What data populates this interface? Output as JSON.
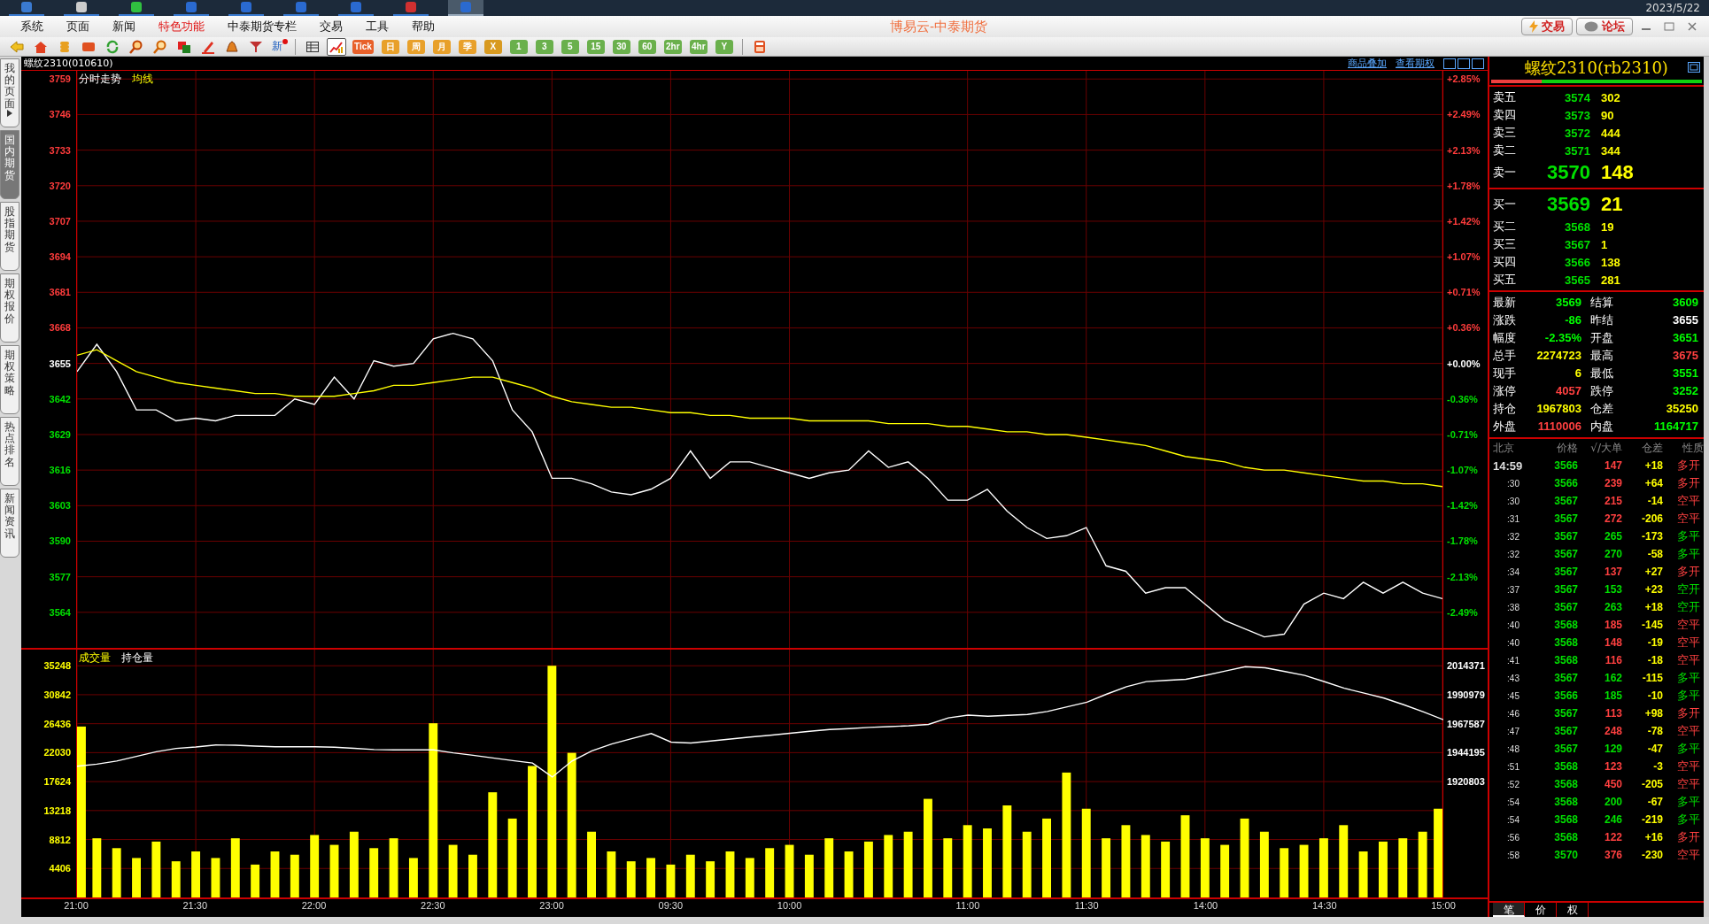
{
  "taskbar": {
    "apps": [
      {
        "selected": false
      },
      {
        "selected": false
      },
      {
        "selected": false
      },
      {
        "selected": false
      },
      {
        "selected": false
      },
      {
        "selected": false
      },
      {
        "selected": false
      },
      {
        "selected": false
      },
      {
        "selected": true
      }
    ],
    "date": "2023/5/22"
  },
  "menu": [
    {
      "label": "系统",
      "highlight": false
    },
    {
      "label": "页面",
      "highlight": false
    },
    {
      "label": "新闻",
      "highlight": false
    },
    {
      "label": "特色功能",
      "highlight": true
    },
    {
      "label": "中泰期货专栏",
      "highlight": false
    },
    {
      "label": "交易",
      "highlight": false
    },
    {
      "label": "工具",
      "highlight": false
    },
    {
      "label": "帮助",
      "highlight": false
    }
  ],
  "app_title": "博易云-中泰期货",
  "header_buttons": [
    {
      "label": "交易",
      "kind": "trade"
    },
    {
      "label": "论坛",
      "kind": "forum"
    }
  ],
  "toolbar": [
    {
      "kind": "icon",
      "selected": false
    },
    {
      "kind": "icon",
      "selected": false
    },
    {
      "kind": "icon",
      "selected": false
    },
    {
      "kind": "icon",
      "selected": false
    },
    {
      "kind": "icon",
      "selected": false
    },
    {
      "kind": "icon",
      "selected": false
    },
    {
      "kind": "icon",
      "selected": false
    },
    {
      "kind": "icon",
      "selected": false
    },
    {
      "kind": "icon",
      "selected": false
    },
    {
      "kind": "icon",
      "selected": false
    },
    {
      "kind": "icon",
      "selected": false
    },
    {
      "kind": "new",
      "label": "新"
    },
    {
      "kind": "separator"
    },
    {
      "kind": "icon",
      "selected": false
    },
    {
      "kind": "icon",
      "selected": true
    },
    {
      "kind": "period",
      "label": "Tick",
      "color": "#e8602a"
    },
    {
      "kind": "period",
      "label": "日",
      "color": "#e8a02a"
    },
    {
      "kind": "period",
      "label": "周",
      "color": "#e8a02a"
    },
    {
      "kind": "period",
      "label": "月",
      "color": "#e8a02a"
    },
    {
      "kind": "period",
      "label": "季",
      "color": "#e8a02a"
    },
    {
      "kind": "period",
      "label": "X",
      "color": "#d89a20"
    },
    {
      "kind": "period",
      "label": "1",
      "color": "#6ab04c"
    },
    {
      "kind": "period",
      "label": "3",
      "color": "#6ab04c"
    },
    {
      "kind": "period",
      "label": "5",
      "color": "#6ab04c"
    },
    {
      "kind": "period",
      "label": "15",
      "color": "#6ab04c"
    },
    {
      "kind": "period",
      "label": "30",
      "color": "#6ab04c"
    },
    {
      "kind": "period",
      "label": "60",
      "color": "#6ab04c"
    },
    {
      "kind": "period",
      "label": "2hr",
      "color": "#6ab04c"
    },
    {
      "kind": "period",
      "label": "4hr",
      "color": "#6ab04c"
    },
    {
      "kind": "period",
      "label": "Y",
      "color": "#6ab04c"
    },
    {
      "kind": "separator"
    },
    {
      "kind": "icon",
      "selected": false
    }
  ],
  "sidebar_tabs": [
    {
      "label": "我的页面",
      "selected": false,
      "expandable": true
    },
    {
      "label": "国内期货",
      "selected": true,
      "expandable": false
    },
    {
      "label": "股指期货",
      "selected": false,
      "expandable": false
    },
    {
      "label": "期权报价",
      "selected": false,
      "expandable": false
    },
    {
      "label": "期权策略",
      "selected": false,
      "expandable": false
    },
    {
      "label": "热点排名",
      "selected": false,
      "expandable": false
    },
    {
      "label": "新闻资讯",
      "selected": false,
      "expandable": false
    }
  ],
  "chart_header": {
    "symbol": "螺纹2310(010610)",
    "links": [
      "商品叠加",
      "查看期权"
    ]
  },
  "price_panel": {
    "percent_ticks": [
      {
        "label": "+2.85%",
        "color": "#ff3c3c"
      },
      {
        "label": "+2.49%",
        "color": "#ff3c3c"
      },
      {
        "label": "+2.13%",
        "color": "#ff3c3c"
      },
      {
        "label": "+1.78%",
        "color": "#ff3c3c"
      },
      {
        "label": "+1.42%",
        "color": "#ff3c3c"
      },
      {
        "label": "+1.07%",
        "color": "#ff3c3c"
      },
      {
        "label": "+0.71%",
        "color": "#ff3c3c"
      },
      {
        "label": "+0.36%",
        "color": "#ff3c3c"
      },
      {
        "label": "+0.00%",
        "color": "#ffffff"
      },
      {
        "label": "-0.36%",
        "color": "#00e000"
      },
      {
        "label": "-0.71%",
        "color": "#00e000"
      },
      {
        "label": "-1.07%",
        "color": "#00e000"
      },
      {
        "label": "-1.42%",
        "color": "#00e000"
      },
      {
        "label": "-1.78%",
        "color": "#00e000"
      },
      {
        "label": "-2.13%",
        "color": "#00e000"
      },
      {
        "label": "-2.49%",
        "color": "#00e000"
      }
    ],
    "chart_data": {
      "type": "line",
      "grid": true,
      "ylim": [
        3551,
        3762
      ],
      "series": [
        {
          "name": "分时走势",
          "color": "#ffffff",
          "values": [
            3652,
            3662,
            3652,
            3638,
            3638,
            3634,
            3635,
            3634,
            3636,
            3636,
            3636,
            3642,
            3640,
            3650,
            3642,
            3656,
            3654,
            3655,
            3664,
            3666,
            3664,
            3656,
            3638,
            3630,
            3613,
            3613,
            3611,
            3608,
            3607,
            3609,
            3613,
            3623,
            3613,
            3619,
            3619,
            3617,
            3615,
            3613,
            3615,
            3616,
            3623,
            3617,
            3619,
            3613,
            3605,
            3605,
            3609,
            3601,
            3595,
            3591,
            3592,
            3595,
            3581,
            3579,
            3571,
            3573,
            3573,
            3567,
            3561,
            3558,
            3555,
            3556,
            3567,
            3571,
            3569,
            3575,
            3571,
            3575,
            3571,
            3569
          ]
        },
        {
          "name": "均线",
          "color": "#ffff00",
          "values": [
            3658,
            3660,
            3656,
            3652,
            3650,
            3648,
            3647,
            3646,
            3645,
            3644,
            3644,
            3643,
            3643,
            3643,
            3644,
            3645,
            3647,
            3647,
            3648,
            3649,
            3650,
            3650,
            3648,
            3646,
            3643,
            3641,
            3640,
            3639,
            3639,
            3638,
            3637,
            3637,
            3636,
            3636,
            3635,
            3635,
            3635,
            3634,
            3634,
            3634,
            3634,
            3633,
            3633,
            3633,
            3632,
            3632,
            3631,
            3630,
            3630,
            3629,
            3629,
            3628,
            3627,
            3626,
            3625,
            3623,
            3621,
            3620,
            3619,
            3617,
            3616,
            3616,
            3615,
            3614,
            3613,
            3612,
            3612,
            3611,
            3611,
            3610
          ]
        }
      ],
      "yticks": [
        {
          "value": 3759,
          "label": "3759"
        },
        {
          "value": 3746,
          "label": "3746"
        },
        {
          "value": 3733,
          "label": "3733"
        },
        {
          "value": 3720,
          "label": "3720"
        },
        {
          "value": 3707,
          "label": "3707"
        },
        {
          "value": 3694,
          "label": "3694"
        },
        {
          "value": 3681,
          "label": "3681"
        },
        {
          "value": 3668,
          "label": "3668"
        },
        {
          "value": 3655,
          "label": "3655"
        },
        {
          "value": 3642,
          "label": "3642"
        },
        {
          "value": 3629,
          "label": "3629"
        },
        {
          "value": 3616,
          "label": "3616"
        },
        {
          "value": 3603,
          "label": "3603"
        },
        {
          "value": 3590,
          "label": "3590"
        },
        {
          "value": 3577,
          "label": "3577"
        },
        {
          "value": 3564,
          "label": "3564"
        }
      ]
    }
  },
  "volume_panel": {
    "time_axis": [
      "21:00",
      "21:30",
      "22:00",
      "22:30",
      "23:00",
      "09:30",
      "10:00",
      "11:00",
      "11:30",
      "14:00",
      "14:30",
      "15:00"
    ],
    "chart_data": {
      "type": "bar",
      "grid": true,
      "ylim": [
        0,
        37700
      ],
      "series": [
        {
          "name": "成交量",
          "color": "#ffff00",
          "values": [
            26000,
            9000,
            7500,
            6000,
            8500,
            5500,
            7000,
            6000,
            9000,
            5000,
            7000,
            6500,
            9500,
            8000,
            10000,
            7500,
            9000,
            6000,
            26500,
            8000,
            6500,
            16000,
            12000,
            20000,
            35248,
            22000,
            10000,
            7000,
            5500,
            6000,
            5000,
            6500,
            5500,
            7000,
            6000,
            7500,
            8000,
            6500,
            9000,
            7000,
            8500,
            9500,
            10000,
            15000,
            9000,
            11000,
            10500,
            14000,
            10000,
            12000,
            19000,
            13500,
            9000,
            11000,
            9500,
            8500,
            12500,
            9000,
            8000,
            12000,
            10000,
            7500,
            8000,
            9000,
            11000,
            7000,
            8500,
            9000,
            10000,
            13500
          ]
        }
      ],
      "yticks": [
        {
          "value": 35248,
          "label": "35248"
        },
        {
          "value": 30842,
          "label": "30842"
        },
        {
          "value": 26436,
          "label": "26436"
        },
        {
          "value": 22030,
          "label": "22030"
        },
        {
          "value": 17624,
          "label": "17624"
        },
        {
          "value": 13218,
          "label": "13218"
        },
        {
          "value": 8812,
          "label": "8812"
        },
        {
          "value": 4406,
          "label": "4406"
        }
      ]
    }
  },
  "open_interest": {
    "chart_data": {
      "type": "line",
      "ylim": [
        1920803,
        2014371
      ],
      "series": [
        {
          "name": "持仓量",
          "color": "#ffffff",
          "values": [
            1933000,
            1934700,
            1937200,
            1941000,
            1944700,
            1947400,
            1948600,
            1950200,
            1950000,
            1949300,
            1948800,
            1948800,
            1948800,
            1948400,
            1947500,
            1946500,
            1946200,
            1946200,
            1946200,
            1943800,
            1941900,
            1939700,
            1937600,
            1935660,
            1924300,
            1937300,
            1945500,
            1951000,
            1955300,
            1959400,
            1952500,
            1951800,
            1953400,
            1955000,
            1956600,
            1958100,
            1959700,
            1961300,
            1962700,
            1963400,
            1964400,
            1965000,
            1965700,
            1966800,
            1972100,
            1974300,
            1973400,
            1974100,
            1974900,
            1977300,
            1981000,
            1984800,
            1991300,
            1997300,
            2001400,
            2002400,
            2003300,
            2006500,
            2010000,
            2013500,
            2012600,
            2009500,
            2006400,
            2001300,
            1996000,
            1992100,
            1988100,
            1982700,
            1976900,
            1970650
          ]
        }
      ],
      "yticks": [
        {
          "value": 2014371,
          "label": "2014371"
        },
        {
          "value": 1990979,
          "label": "1990979"
        },
        {
          "value": 1967587,
          "label": "1967587"
        },
        {
          "value": 1944195,
          "label": "1944195"
        },
        {
          "value": 1920803,
          "label": "1920803"
        }
      ]
    }
  },
  "quote": {
    "title": "螺纹2310(rb2310)",
    "ratio": {
      "level": 0.24
    },
    "asks": [
      {
        "label": "卖五",
        "price": "3574",
        "volume": "302",
        "kind": "normal"
      },
      {
        "label": "卖四",
        "price": "3573",
        "volume": "90",
        "kind": "normal"
      },
      {
        "label": "卖三",
        "price": "3572",
        "volume": "444",
        "kind": "normal"
      },
      {
        "label": "卖二",
        "price": "3571",
        "volume": "344",
        "kind": "normal"
      },
      {
        "label": "卖一",
        "price": "3570",
        "volume": "148",
        "kind": "best"
      }
    ],
    "bids": [
      {
        "label": "买一",
        "price": "3569",
        "volume": "21",
        "kind": "best"
      },
      {
        "label": "买二",
        "price": "3568",
        "volume": "19",
        "kind": "normal"
      },
      {
        "label": "买三",
        "price": "3567",
        "volume": "1",
        "kind": "normal"
      },
      {
        "label": "买四",
        "price": "3566",
        "volume": "138",
        "kind": "normal"
      },
      {
        "label": "买五",
        "price": "3565",
        "volume": "281",
        "kind": "normal"
      }
    ],
    "stats": [
      {
        "label": "最新",
        "value": "3569",
        "color": "#00ff00"
      },
      {
        "label": "结算",
        "value": "3609",
        "color": "#00ff00"
      },
      {
        "label": "涨跌",
        "value": "-86",
        "color": "#00ff00"
      },
      {
        "label": "昨结",
        "value": "3655",
        "color": "#ffffff"
      },
      {
        "label": "幅度",
        "value": "-2.35%",
        "color": "#00ff00"
      },
      {
        "label": "开盘",
        "value": "3651",
        "color": "#00ff00"
      },
      {
        "label": "总手",
        "value": "2274723",
        "color": "#ffff00"
      },
      {
        "label": "最高",
        "value": "3675",
        "color": "#ff4040"
      },
      {
        "label": "现手",
        "value": "6",
        "color": "#ffff00"
      },
      {
        "label": "最低",
        "value": "3551",
        "color": "#00ff00"
      },
      {
        "label": "涨停",
        "value": "4057",
        "color": "#ff4040"
      },
      {
        "label": "跌停",
        "value": "3252",
        "color": "#00ff00"
      },
      {
        "label": "持仓",
        "value": "1967803",
        "color": "#ffff00"
      },
      {
        "label": "仓差",
        "value": "35250",
        "color": "#ffff00"
      },
      {
        "label": "外盘",
        "value": "1110006",
        "color": "#ff4040"
      },
      {
        "label": "内盘",
        "value": "1164717",
        "color": "#00ff00"
      }
    ],
    "tick_columns": [
      "北京",
      "价格",
      "√/大单",
      "仓差",
      "性质"
    ],
    "ticks": [
      {
        "time": "14:59",
        "price": "3566",
        "volume": "147",
        "oi": "+18",
        "nature": "多开",
        "color": "#ff4040"
      },
      {
        "time": ":30",
        "price": "3566",
        "volume": "239",
        "oi": "+64",
        "nature": "多开",
        "color": "#ff4040"
      },
      {
        "time": ":30",
        "price": "3567",
        "volume": "215",
        "oi": "-14",
        "nature": "空平",
        "color": "#ff4040"
      },
      {
        "time": ":31",
        "price": "3567",
        "volume": "272",
        "oi": "-206",
        "nature": "空平",
        "color": "#ff4040"
      },
      {
        "time": ":32",
        "price": "3567",
        "volume": "265",
        "oi": "-173",
        "nature": "多平",
        "color": "#00e000"
      },
      {
        "time": ":32",
        "price": "3567",
        "volume": "270",
        "oi": "-58",
        "nature": "多平",
        "color": "#00e000"
      },
      {
        "time": ":34",
        "price": "3567",
        "volume": "137",
        "oi": "+27",
        "nature": "多开",
        "color": "#ff4040"
      },
      {
        "time": ":37",
        "price": "3567",
        "volume": "153",
        "oi": "+23",
        "nature": "空开",
        "color": "#00e000"
      },
      {
        "time": ":38",
        "price": "3567",
        "volume": "263",
        "oi": "+18",
        "nature": "空开",
        "color": "#00e000"
      },
      {
        "time": ":40",
        "price": "3568",
        "volume": "185",
        "oi": "-145",
        "nature": "空平",
        "color": "#ff4040"
      },
      {
        "time": ":40",
        "price": "3568",
        "volume": "148",
        "oi": "-19",
        "nature": "空平",
        "color": "#ff4040"
      },
      {
        "time": ":41",
        "price": "3568",
        "volume": "116",
        "oi": "-18",
        "nature": "空平",
        "color": "#ff4040"
      },
      {
        "time": ":43",
        "price": "3567",
        "volume": "162",
        "oi": "-115",
        "nature": "多平",
        "color": "#00e000"
      },
      {
        "time": ":45",
        "price": "3566",
        "volume": "185",
        "oi": "-10",
        "nature": "多平",
        "color": "#00e000"
      },
      {
        "time": ":46",
        "price": "3567",
        "volume": "113",
        "oi": "+98",
        "nature": "多开",
        "color": "#ff4040"
      },
      {
        "time": ":47",
        "price": "3567",
        "volume": "248",
        "oi": "-78",
        "nature": "空平",
        "color": "#ff4040"
      },
      {
        "time": ":48",
        "price": "3567",
        "volume": "129",
        "oi": "-47",
        "nature": "多平",
        "color": "#00e000"
      },
      {
        "time": ":51",
        "price": "3568",
        "volume": "123",
        "oi": "-3",
        "nature": "空平",
        "color": "#ff4040"
      },
      {
        "time": ":52",
        "price": "3568",
        "volume": "450",
        "oi": "-205",
        "nature": "空平",
        "color": "#ff4040"
      },
      {
        "time": ":54",
        "price": "3568",
        "volume": "200",
        "oi": "-67",
        "nature": "多平",
        "color": "#00e000"
      },
      {
        "time": ":54",
        "price": "3568",
        "volume": "246",
        "oi": "-219",
        "nature": "多平",
        "color": "#00e000"
      },
      {
        "time": ":56",
        "price": "3568",
        "volume": "122",
        "oi": "+16",
        "nature": "多开",
        "color": "#ff4040"
      },
      {
        "time": ":58",
        "price": "3570",
        "volume": "376",
        "oi": "-230",
        "nature": "空平",
        "color": "#ff4040"
      }
    ],
    "bottom_tabs": [
      {
        "label": "笔",
        "selected": true
      },
      {
        "label": "价",
        "selected": false
      },
      {
        "label": "权",
        "selected": false
      }
    ]
  }
}
